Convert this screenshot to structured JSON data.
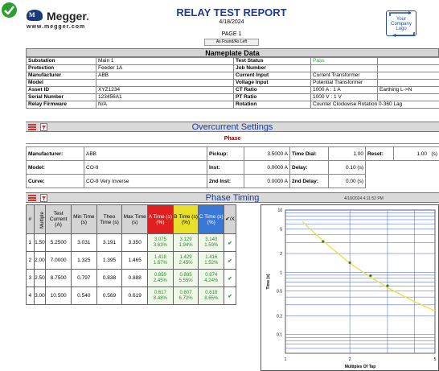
{
  "header": {
    "brand": "Megger",
    "brand_dot": ".",
    "brand_url": "www.megger.com",
    "title": "RELAY TEST REPORT",
    "date": "4/18/2024",
    "page": "PAGE 1",
    "found_left_button": "As Found/As Left",
    "company_logo": [
      "Your",
      "Company",
      "Logo"
    ]
  },
  "nameplate": {
    "title": "Nameplate Data",
    "rows": [
      {
        "l1": "Substation",
        "v1": "Main 1",
        "l2": "Test Status",
        "v2": "Pass",
        "v3": ""
      },
      {
        "l1": "Protection",
        "v1": "Feeder 1A",
        "l2": "Job Number",
        "v2": "",
        "v3": ""
      },
      {
        "l1": "Manufacturer",
        "v1": "ABB",
        "l2": "Current Input",
        "v2": "Current Transformer",
        "v3": ""
      },
      {
        "l1": "Model",
        "v1": "",
        "l2": "Voltage Input",
        "v2": "Potential Transformer",
        "v3": ""
      },
      {
        "l1": "Asset ID",
        "v1": "XYZ1234",
        "l2": "CT Ratio",
        "v2": "1000 A : 1 A",
        "v3": "Earthing L->N"
      },
      {
        "l1": "Serial Number",
        "v1": "123456A1",
        "l2": "PT Ratio",
        "v2": "1000 V : 1 V",
        "v3": ""
      },
      {
        "l1": "Relay Firmware",
        "v1": "N/A",
        "l2": "Rotation",
        "v2": "Counter Clockwise Rotation  0-360 Lag",
        "v3": ""
      }
    ]
  },
  "overcurrent": {
    "title": "Overcurrent Settings",
    "phase_label": "Phase",
    "manufacturer_label": "Manufacturer:",
    "manufacturer": "ABB",
    "model_label": "Model:",
    "model": "CO-9",
    "curve_label": "Curve:",
    "curve": "CO-9 Very Inverse",
    "pickup_label": "Pickup:",
    "pickup": "3.5000 A",
    "inst_label": "Inst:",
    "inst": "0.0000 A",
    "inst2_label": "2nd Inst:",
    "inst2": "0.0000 A",
    "time_dial_label": "Time Dial:",
    "time_dial": "1.00",
    "delay_label": "Delay:",
    "delay": "0.10 (s)",
    "delay2_label": "2nd Delay:",
    "delay2": "0.00 (s)",
    "reset_label": "Reset:",
    "reset": "1.00",
    "reset_unit": "(s)"
  },
  "phase_timing": {
    "title": "Phase Timing",
    "timestamp": "4/18/2024 4:11:52 PM",
    "headers": {
      "num": "#",
      "multiple": "Multiple",
      "test_current": "Test Current (A)",
      "min_time": "Min Time (s)",
      "theo_time": "Theo Time (s)",
      "max_time": "Max Time (s)",
      "a": "A Time (s) (%)",
      "b": "B Time (s) (%)",
      "c": "C Time (s) (%)",
      "result": "✔/X"
    },
    "rows": [
      {
        "n": "1",
        "mult": "1.50",
        "cur": "5.2500",
        "min": "3.031",
        "theo": "3.191",
        "max": "3.350",
        "a": "3.075",
        "ap": "3.63%",
        "b": "3.129",
        "bp": "1.94%",
        "c": "3.140",
        "cp": "1.59%",
        "ok": "✔"
      },
      {
        "n": "2",
        "mult": "2.00",
        "cur": "7.0000",
        "min": "1.325",
        "theo": "1.395",
        "max": "1.465",
        "a": "1.418",
        "ap": "1.67%",
        "b": "1.429",
        "bp": "2.45%",
        "c": "1.416",
        "cp": "1.52%",
        "ok": "✔"
      },
      {
        "n": "3",
        "mult": "2.50",
        "cur": "8.7500",
        "min": "0.797",
        "theo": "0.838",
        "max": "0.888",
        "a": "0.859",
        "ap": "2.45%",
        "b": "0.885",
        "bp": "5.55%",
        "c": "0.874",
        "cp": "4.24%",
        "ok": "✔"
      },
      {
        "n": "4",
        "mult": "3.00",
        "cur": "10.500",
        "min": "0.540",
        "theo": "0.569",
        "max": "0.619",
        "a": "0.617",
        "ap": "8.48%",
        "b": "0.607",
        "bp": "6.72%",
        "c": "0.618",
        "cp": "8.65%",
        "ok": "✔"
      }
    ]
  },
  "chart_data": {
    "type": "line",
    "xlabel": "Multiples Of Tap",
    "ylabel": "Time (s)",
    "x_scale": "log",
    "y_scale": "log",
    "xlim": [
      1,
      5
    ],
    "ylim": [
      0.05,
      10
    ],
    "x_ticks": [
      "1",
      "2",
      "5"
    ],
    "y_ticks": [
      "10",
      "5",
      "2",
      "1",
      "0.5",
      "0.2",
      "0.1"
    ],
    "grid": true,
    "series": [
      {
        "color": "#f0e040",
        "x": [
          1.2,
          1.5,
          2.0,
          2.5,
          3.0,
          3.5,
          4.0,
          5.0
        ],
        "y": [
          6.5,
          3.191,
          1.395,
          0.838,
          0.569,
          0.43,
          0.34,
          0.24
        ]
      }
    ],
    "points": {
      "x": [
        1.5,
        2.0,
        2.5,
        3.0
      ],
      "y": [
        3.129,
        1.429,
        0.885,
        0.607
      ]
    }
  }
}
